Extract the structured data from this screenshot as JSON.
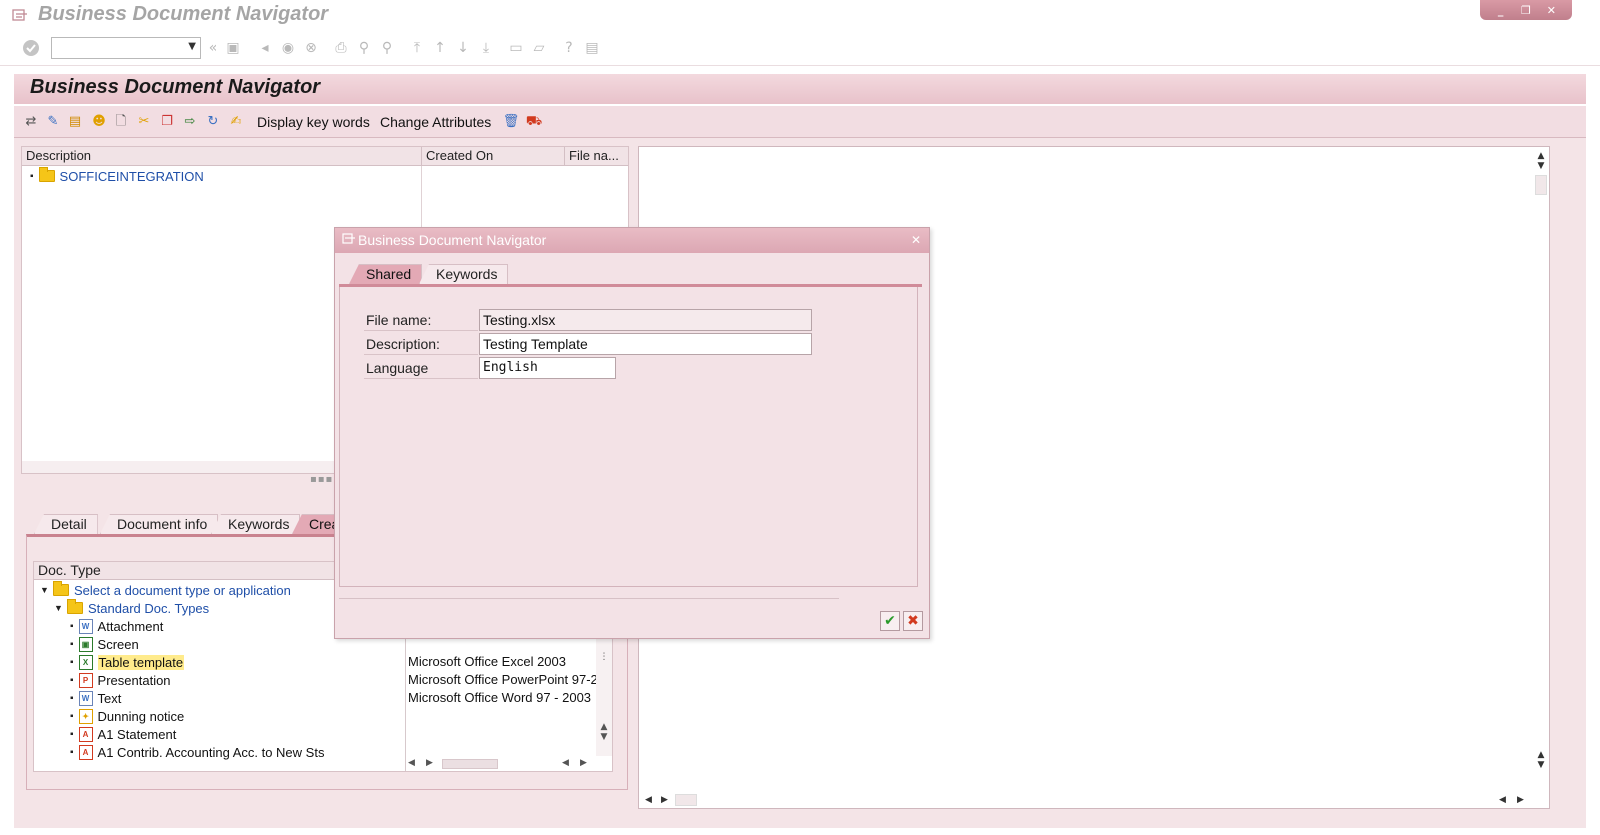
{
  "window": {
    "title": "Business Document Navigator",
    "controls": [
      "_",
      "❐",
      "✕"
    ]
  },
  "system_toolbar": {
    "command_field": {
      "value": "",
      "placeholder": ""
    }
  },
  "app": {
    "title": "Business Document Navigator",
    "toolbar": {
      "display_keywords_label": "Display key words",
      "change_attributes_label": "Change Attributes"
    }
  },
  "tree": {
    "columns": [
      "Description",
      "Created On",
      "File na..."
    ],
    "root_item": "SOFFICEINTEGRATION"
  },
  "lower_tabs": [
    "Detail",
    "Document info",
    "Keywords",
    "Creat"
  ],
  "doc_types": {
    "header": "Doc. Type",
    "root_folder": "Select a document type or application",
    "sub_folder": "Standard Doc. Types",
    "items": [
      {
        "label": "Attachment",
        "app": ""
      },
      {
        "label": "Screen",
        "app": ""
      },
      {
        "label": "Table template",
        "app": "Microsoft Office Excel 2003"
      },
      {
        "label": "Presentation",
        "app": "Microsoft Office PowerPoint 97-2"
      },
      {
        "label": "Text",
        "app": "Microsoft Office Word 97 - 2003"
      },
      {
        "label": "Dunning notice",
        "app": ""
      },
      {
        "label": "A1 Statement",
        "app": ""
      },
      {
        "label": "A1 Contrib. Accounting Acc. to New Sts",
        "app": ""
      }
    ],
    "selected_item": "Table template"
  },
  "dialog": {
    "title": "Business Document Navigator",
    "tabs": [
      "Shared",
      "Keywords"
    ],
    "active_tab": "Shared",
    "fields": {
      "file_name_label": "File name:",
      "file_name_value": "Testing.xlsx",
      "description_label": "Description:",
      "description_value": "Testing Template",
      "language_label": "Language",
      "language_value": "English"
    }
  },
  "colors": {
    "accent": "#c9828f",
    "title_band": "#e8c2ca",
    "selection": "#ffeb8c",
    "link_blue": "#1f4fa8",
    "ok_green": "#2b9a2b",
    "cancel_red": "#d23a1f"
  }
}
